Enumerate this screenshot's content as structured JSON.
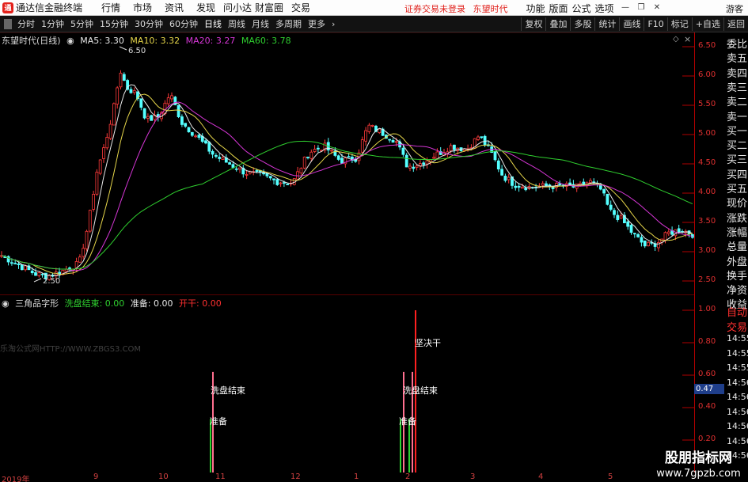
{
  "app": {
    "title": "通达信金融终端",
    "menu": [
      "行情",
      "市场",
      "资讯",
      "发现",
      "问小达",
      "财富圈",
      "交易"
    ],
    "status": [
      "证券交易未登录",
      "东望时代"
    ],
    "right_menu": [
      "功能",
      "版面",
      "公式",
      "选项"
    ],
    "guest": "游客"
  },
  "toolbar": {
    "periods": [
      "分时",
      "1分钟",
      "5分钟",
      "15分钟",
      "30分钟",
      "60分钟",
      "日线",
      "周线",
      "月线",
      "多周期",
      "更多"
    ],
    "active": "日线",
    "right_tools": [
      "复权",
      "叠加",
      "多股",
      "统计",
      "画线",
      "F10",
      "标记",
      "+自选",
      "返回"
    ]
  },
  "main_chart": {
    "stock": "东望时代(日线)",
    "ma": [
      {
        "label": "MA5: 3.30",
        "color": "#e8e8e8"
      },
      {
        "label": "MA10: 3.32",
        "color": "#e6d64a"
      },
      {
        "label": "MA20: 3.27",
        "color": "#d636d6"
      },
      {
        "label": "MA60: 3.78",
        "color": "#2fcf2f"
      }
    ],
    "high_label": "6.50",
    "low_label": "2.50",
    "y_ticks": [
      "6.50",
      "6.00",
      "5.50",
      "5.00",
      "4.50",
      "4.00",
      "3.50",
      "3.00",
      "2.50"
    ]
  },
  "indicator": {
    "name": "三角品字形",
    "vars": [
      {
        "label": "洗盘结束: 0.00",
        "color": "#2fcf2f"
      },
      {
        "label": "准备: 0.00",
        "color": "#e8e8e8"
      },
      {
        "label": "开干: 0.00",
        "color": "#ff3030"
      }
    ],
    "y_ticks": [
      "1.00",
      "0.80",
      "0.60",
      "0.40",
      "0.20"
    ],
    "annotations": [
      "坚决干",
      "洗盘结束",
      "准备",
      "洗盘结束",
      "准备"
    ],
    "current_value": "0.47"
  },
  "x_axis": [
    "2019年",
    "9",
    "10",
    "11",
    "12",
    "1",
    "2",
    "3",
    "4",
    "5"
  ],
  "sidebar_top": [
    "委比",
    "卖五",
    "卖四",
    "卖三",
    "卖二",
    "卖一",
    "买一",
    "买二",
    "买三",
    "买四",
    "买五",
    "现价",
    "涨跌",
    "涨幅",
    "总量",
    "外盘",
    "换手",
    "净资",
    "收益"
  ],
  "sidebar_bottom": [
    "自动",
    "交易",
    "14:55",
    "14:55",
    "14:55",
    "14:56",
    "14:56",
    "14:56",
    "14:56",
    "14:56",
    "14:56"
  ],
  "watermarks": {
    "left": "乐淘公式网HTTP://WWW.ZBGS3.COM",
    "right_title": "股朋指标网",
    "right_url": "www.7gpzb.com"
  },
  "colors": {
    "up": "#ff3a3a",
    "down": "#54ffff",
    "ma60": "#2fcf2f",
    "axis": "#b00000"
  }
}
